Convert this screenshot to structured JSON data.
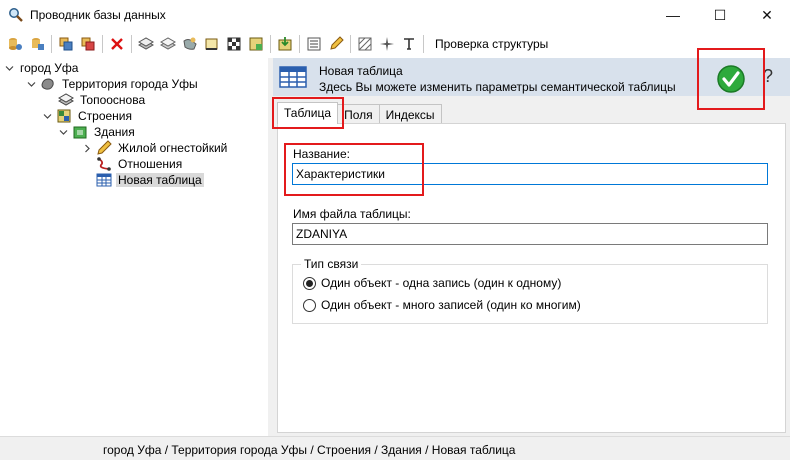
{
  "window": {
    "title": "Проводник базы данных",
    "minimize_glyph": "—",
    "maximize_glyph": "☐",
    "close_glyph": "✕"
  },
  "toolbar": {
    "icons": [
      "db-connect-icon",
      "db-open-icon",
      "db-copy-icon",
      "db-move-icon",
      "delete-icon",
      "layer-icon",
      "layer-copy-icon",
      "map-icon",
      "book-icon",
      "checker-icon",
      "grid-icon",
      "import-icon",
      "list-icon",
      "pencil-icon",
      "hatch-icon",
      "crosshair-icon",
      "text-tool-icon"
    ],
    "check_structure_label": "Проверка структуры"
  },
  "tree": {
    "items": [
      {
        "label": "город Уфа",
        "icon": "none"
      },
      {
        "label": "Территория города Уфы",
        "icon": "territory-icon"
      },
      {
        "label": "Топооснова",
        "icon": "layers-icon"
      },
      {
        "label": "Строения",
        "icon": "buildings-icon"
      },
      {
        "label": "Здания",
        "icon": "building-icon"
      },
      {
        "label": "Жилой огнестойкий",
        "icon": "pencil-icon"
      },
      {
        "label": "Отношения",
        "icon": "relations-icon"
      },
      {
        "label": "Новая таблица",
        "icon": "table-icon"
      }
    ]
  },
  "panel": {
    "header_title": "Новая таблица",
    "header_subtitle": "Здесь Вы можете изменить параметры семантической таблицы",
    "help_glyph": "?",
    "tabs": [
      {
        "label": "Таблица",
        "active": true
      },
      {
        "label": "Поля",
        "active": false
      },
      {
        "label": "Индексы",
        "active": false
      }
    ],
    "name_label": "Название:",
    "name_value": "Характеристики",
    "file_label": "Имя файла таблицы:",
    "file_value": "ZDANIYA",
    "link_type_title": "Тип связи",
    "link_options": [
      {
        "label": "Один объект - одна запись (один к одному)",
        "checked": true
      },
      {
        "label": "Один объект - много записей (один ко многим)",
        "checked": false
      }
    ]
  },
  "statusbar": {
    "path": "город Уфа / Территория города Уфы / Строения / Здания / Новая таблица"
  },
  "colors": {
    "highlight": "#e31a1c",
    "header_bg": "#d8e1ec",
    "ok_green": "#2eaa3c",
    "focus_border": "#0078d7"
  }
}
